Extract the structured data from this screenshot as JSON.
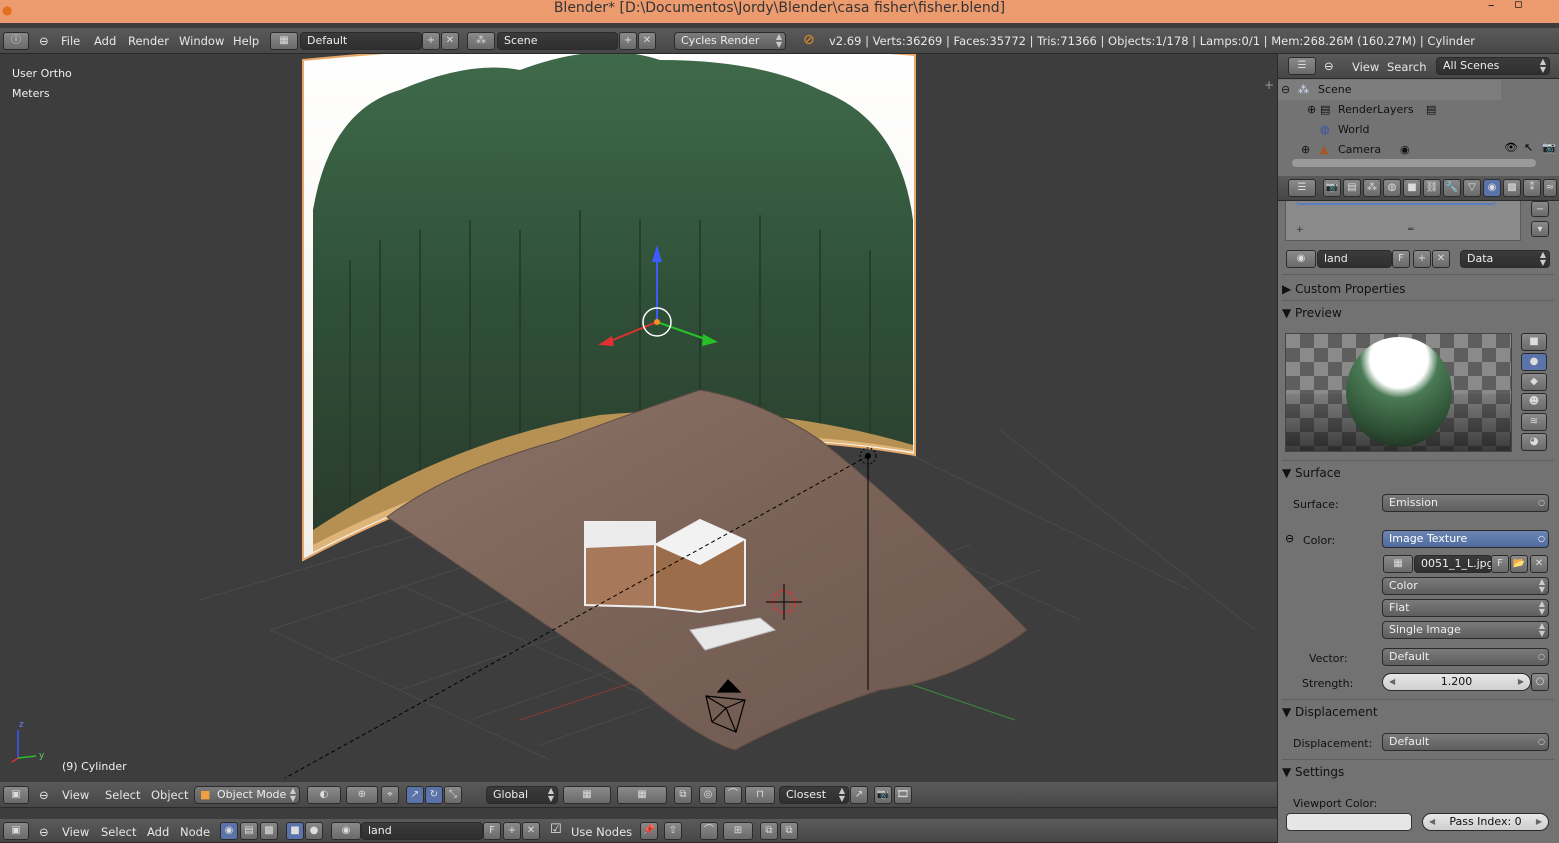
{
  "window": {
    "title": "Blender* [D:\\Documentos\\Jordy\\Blender\\casa fisher\\fisher.blend]"
  },
  "top_menu": {
    "items": [
      "File",
      "Add",
      "Render",
      "Window",
      "Help"
    ],
    "screen_layout": "Default",
    "scene": "Scene",
    "render_engine": "Cycles Render",
    "stats": "v2.69 | Verts:36269 | Faces:35772 | Tris:71366 | Objects:1/178 | Lamps:0/1 | Mem:268.26M (160.27M) | Cylinder"
  },
  "viewport": {
    "view_name": "User Ortho",
    "units": "Meters",
    "active_object": "(9) Cylinder",
    "axis_labels": [
      "z",
      "y"
    ]
  },
  "view3d_header": {
    "items": [
      "View",
      "Select",
      "Object"
    ],
    "mode": "Object Mode",
    "orientation": "Global",
    "snap_element": "Closest"
  },
  "node_header": {
    "items": [
      "View",
      "Select",
      "Add",
      "Node"
    ],
    "material": "land",
    "fake_user": "F",
    "use_nodes_label": "Use Nodes"
  },
  "outliner": {
    "menu": [
      "View",
      "Search"
    ],
    "filter": "All Scenes",
    "rows": [
      "Scene",
      "RenderLayers",
      "World",
      "Camera"
    ]
  },
  "properties": {
    "material_name": "land",
    "fake_user": "F",
    "link": "Data",
    "panels": {
      "custom_properties": "Custom Properties",
      "preview": "Preview",
      "surface": "Surface",
      "displacement": "Displacement",
      "settings": "Settings"
    },
    "surface": {
      "surface_label": "Surface:",
      "surface_value": "Emission",
      "color_label": "Color:",
      "color_value": "Image Texture",
      "image": "0051_1_L.jpg",
      "image_f": "F",
      "color_space": "Color",
      "projection": "Flat",
      "source": "Single Image",
      "vector_label": "Vector:",
      "vector_value": "Default",
      "strength_label": "Strength:",
      "strength_value": "1.200"
    },
    "displacement": {
      "label": "Displacement:",
      "value": "Default"
    },
    "settings": {
      "viewport_color_label": "Viewport Color:",
      "pass_index": "Pass Index: 0"
    }
  }
}
